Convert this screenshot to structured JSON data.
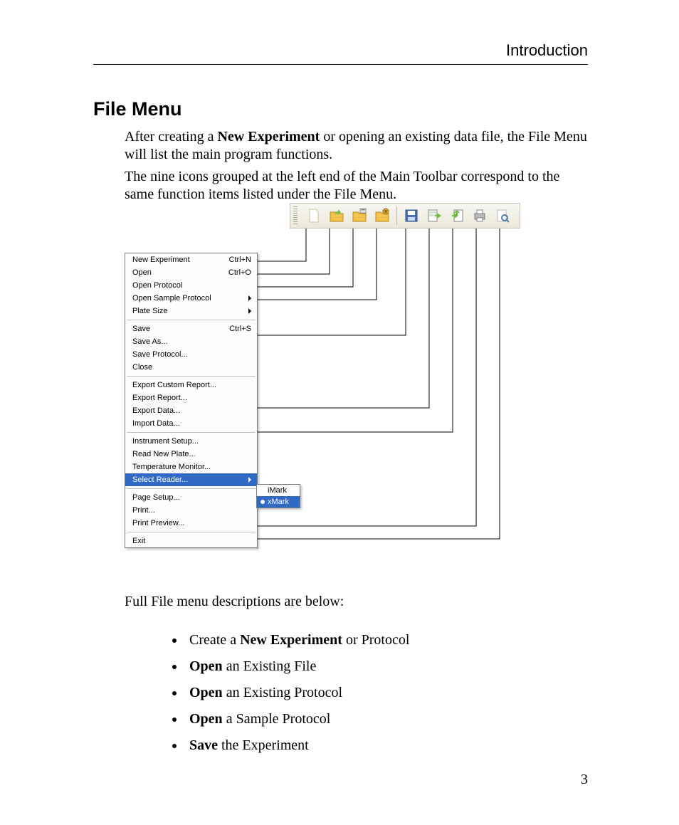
{
  "header": {
    "section_title": "Introduction"
  },
  "heading": "File Menu",
  "para1_pre": "After creating a ",
  "para1_bold": "New Experiment",
  "para1_post": " or opening an existing data file, the File Menu will list the main program functions.",
  "para2": "The nine icons grouped at the left end of the Main Toolbar correspond to the same function items listed under the File Menu.",
  "para3": "Full File menu descriptions are below:",
  "bullets": {
    "b1": {
      "pre": "Create a ",
      "bold": "New Experiment",
      "post": " or Protocol"
    },
    "b2": {
      "bold": "Open",
      "post": " an Existing File"
    },
    "b3": {
      "bold": "Open",
      "post": " an Existing Protocol"
    },
    "b4": {
      "bold": "Open",
      "post": " a Sample Protocol"
    },
    "b5": {
      "bold": "Save",
      "post": " the Experiment"
    }
  },
  "page_number": "3",
  "toolbar": {
    "icons": {
      "new": "new-experiment-icon",
      "open": "open-icon",
      "open_protocol": "open-protocol-icon",
      "open_sample": "open-sample-protocol-icon",
      "save": "save-icon",
      "export": "export-icon",
      "import": "import-icon",
      "print": "print-icon",
      "preview": "print-preview-icon"
    }
  },
  "filemenu": {
    "items": [
      {
        "label": "New Experiment",
        "shortcut": "Ctrl+N"
      },
      {
        "label": "Open",
        "shortcut": "Ctrl+O"
      },
      {
        "label": "Open Protocol"
      },
      {
        "label": "Open Sample Protocol",
        "submenu": true
      },
      {
        "label": "Plate Size",
        "submenu": true
      },
      {
        "sep": true
      },
      {
        "label": "Save",
        "shortcut": "Ctrl+S"
      },
      {
        "label": "Save As..."
      },
      {
        "label": "Save Protocol..."
      },
      {
        "label": "Close"
      },
      {
        "sep": true
      },
      {
        "label": "Export Custom Report..."
      },
      {
        "label": "Export Report..."
      },
      {
        "label": "Export Data..."
      },
      {
        "label": "Import Data..."
      },
      {
        "sep": true
      },
      {
        "label": "Instrument Setup..."
      },
      {
        "label": "Read New Plate..."
      },
      {
        "label": "Temperature Monitor..."
      },
      {
        "label": "Select Reader...",
        "submenu": true,
        "selected": true
      },
      {
        "sep": true
      },
      {
        "label": "Page Setup..."
      },
      {
        "label": "Print..."
      },
      {
        "label": "Print Preview..."
      },
      {
        "sep": true
      },
      {
        "label": "Exit"
      }
    ],
    "submenu": [
      {
        "label": "iMark"
      },
      {
        "label": "xMark",
        "selected": true,
        "checked": true
      }
    ]
  }
}
